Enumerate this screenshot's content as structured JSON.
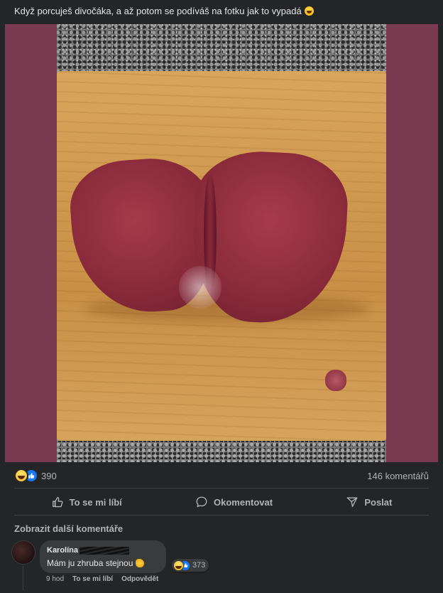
{
  "post": {
    "caption": "Když porcuješ divočáka, a až potom se podíváš na fotku jak to vypadá",
    "caption_emoji": "grinning-squinting-emoji-icon",
    "frame_color": "#7a3a50"
  },
  "stats": {
    "reaction_count": "390",
    "comments_count": "146 komentářů",
    "reaction_icons": [
      "haha-reaction-icon",
      "like-reaction-icon"
    ]
  },
  "actions": {
    "like_label": "To se mi líbí",
    "comment_label": "Okomentovat",
    "share_label": "Poslat"
  },
  "comments_section": {
    "more_label": "Zobrazit další komentáře",
    "items": [
      {
        "author": "Karolína",
        "text": "Mám ju zhruba stejnou",
        "reaction_count": "373",
        "time": "9 hod",
        "like_label": "To se mi líbí",
        "reply_label": "Odpovědět"
      }
    ]
  },
  "colors": {
    "background": "#242526",
    "text": "#e4e6eb",
    "muted": "#b0b3b8",
    "like_blue": "#1877f2",
    "bubble": "#3a3b3c"
  }
}
